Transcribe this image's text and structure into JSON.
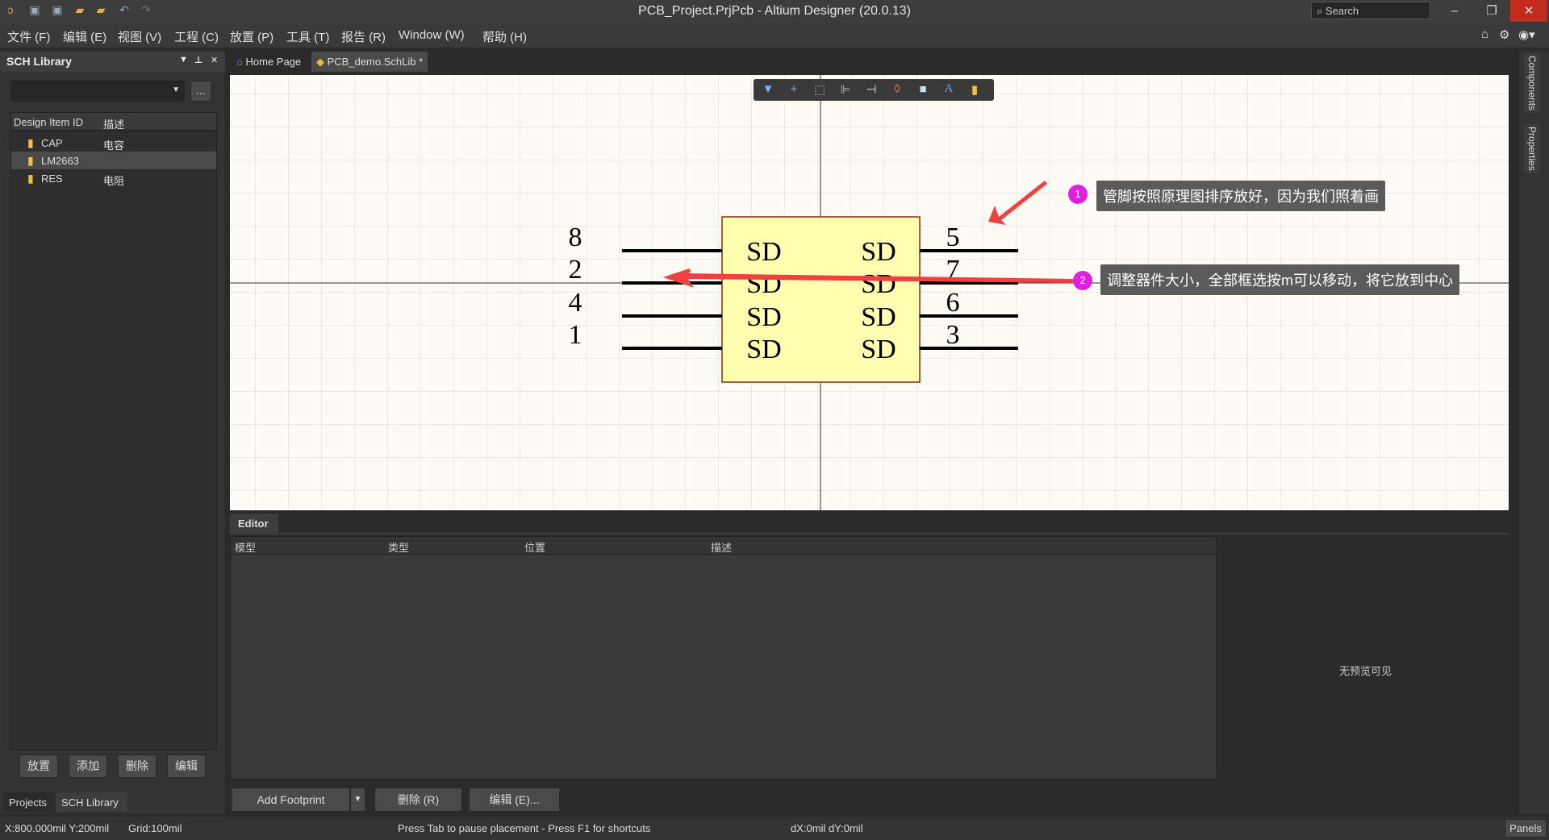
{
  "window": {
    "title": "PCB_Project.PrjPcb - Altium Designer (20.0.13)",
    "search_placeholder": "Search",
    "minimize": "–",
    "restore": "❐",
    "close": "✕"
  },
  "menu": [
    "文件 (F)",
    "编辑 (E)",
    "视图 (V)",
    "工程 (C)",
    "放置 (P)",
    "工具 (T)",
    "报告 (R)",
    "Window (W)",
    "帮助 (H)"
  ],
  "left_panel": {
    "title": "SCH Library",
    "more": "...",
    "columns": [
      "Design Item ID",
      "描述"
    ],
    "items": [
      {
        "id": "CAP",
        "desc": "电容"
      },
      {
        "id": "LM2663",
        "desc": ""
      },
      {
        "id": "RES",
        "desc": "电阻"
      }
    ],
    "selected": "LM2663",
    "buttons": [
      "放置",
      "添加",
      "删除",
      "编辑"
    ],
    "tabs": [
      "Projects",
      "SCH Library"
    ]
  },
  "tabs": [
    {
      "label": "Home Page"
    },
    {
      "label": "PCB_demo.SchLib *"
    }
  ],
  "right_strip": [
    "Components",
    "Properties"
  ],
  "component": {
    "left_pins": [
      "8",
      "2",
      "4",
      "1"
    ],
    "right_pins": [
      "5",
      "7",
      "6",
      "3"
    ],
    "pin_name": "SD",
    "body_color": "#ffffb0"
  },
  "annotations": [
    {
      "num": "1",
      "text": "管脚按照原理图排序放好，因为我们照着画"
    },
    {
      "num": "2",
      "text": "调整器件大小，全部框选按m可以移动，将它放到中心"
    }
  ],
  "editor": {
    "tab": "Editor",
    "columns": [
      "模型",
      "类型",
      "位置",
      "描述"
    ],
    "no_preview": "无预览可见",
    "add_footprint": "Add Footprint",
    "delete": "删除 (R)",
    "edit": "编辑 (E)..."
  },
  "status": {
    "coords": "X:800.000mil Y:200mil",
    "grid": "Grid:100mil",
    "hint": "Press Tab to pause placement - Press F1 for shortcuts",
    "delta": "dX:0mil dY:0mil",
    "panels": "Panels"
  },
  "colors": {
    "accent": "#e020e0",
    "arrow": "#f04040"
  }
}
